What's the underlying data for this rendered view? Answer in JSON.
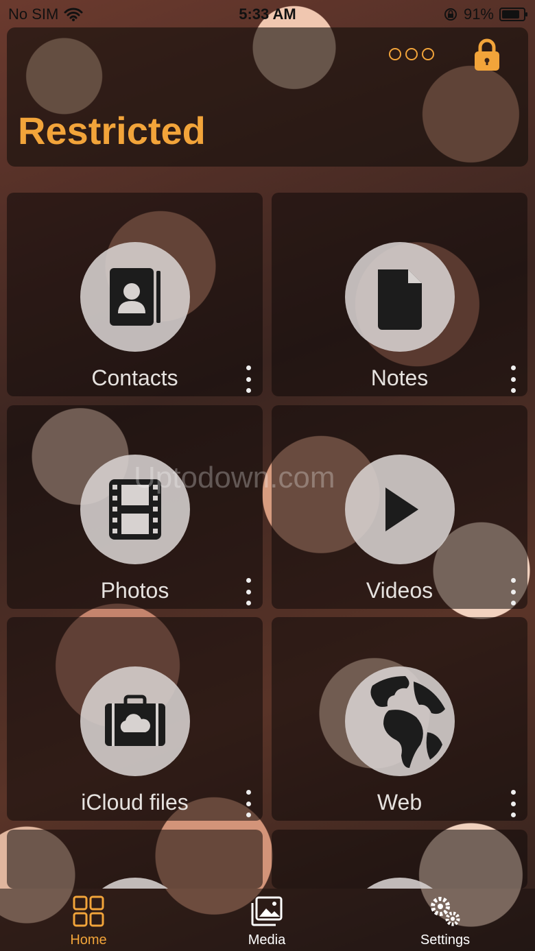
{
  "status_bar": {
    "carrier": "No SIM",
    "time": "5:33 AM",
    "battery": "91%",
    "battery_level": 0.91
  },
  "header": {
    "title": "Restricted",
    "more_icon": "more-circles-icon",
    "lock_icon": "lock-icon",
    "accent_color": "#f2a43a"
  },
  "tiles": [
    {
      "label": "Contacts",
      "icon": "contacts-icon"
    },
    {
      "label": "Notes",
      "icon": "document-icon"
    },
    {
      "label": "Photos",
      "icon": "film-strip-icon"
    },
    {
      "label": "Videos",
      "icon": "play-icon"
    },
    {
      "label": "iCloud files",
      "icon": "cloud-briefcase-icon"
    },
    {
      "label": "Web",
      "icon": "globe-icon"
    }
  ],
  "watermark": "Uptodown.com",
  "tabbar": {
    "items": [
      {
        "label": "Home",
        "icon": "grid-icon",
        "active": true
      },
      {
        "label": "Media",
        "icon": "photo-icon",
        "active": false
      },
      {
        "label": "Settings",
        "icon": "gears-icon",
        "active": false
      }
    ],
    "active_color": "#f2a43a"
  }
}
